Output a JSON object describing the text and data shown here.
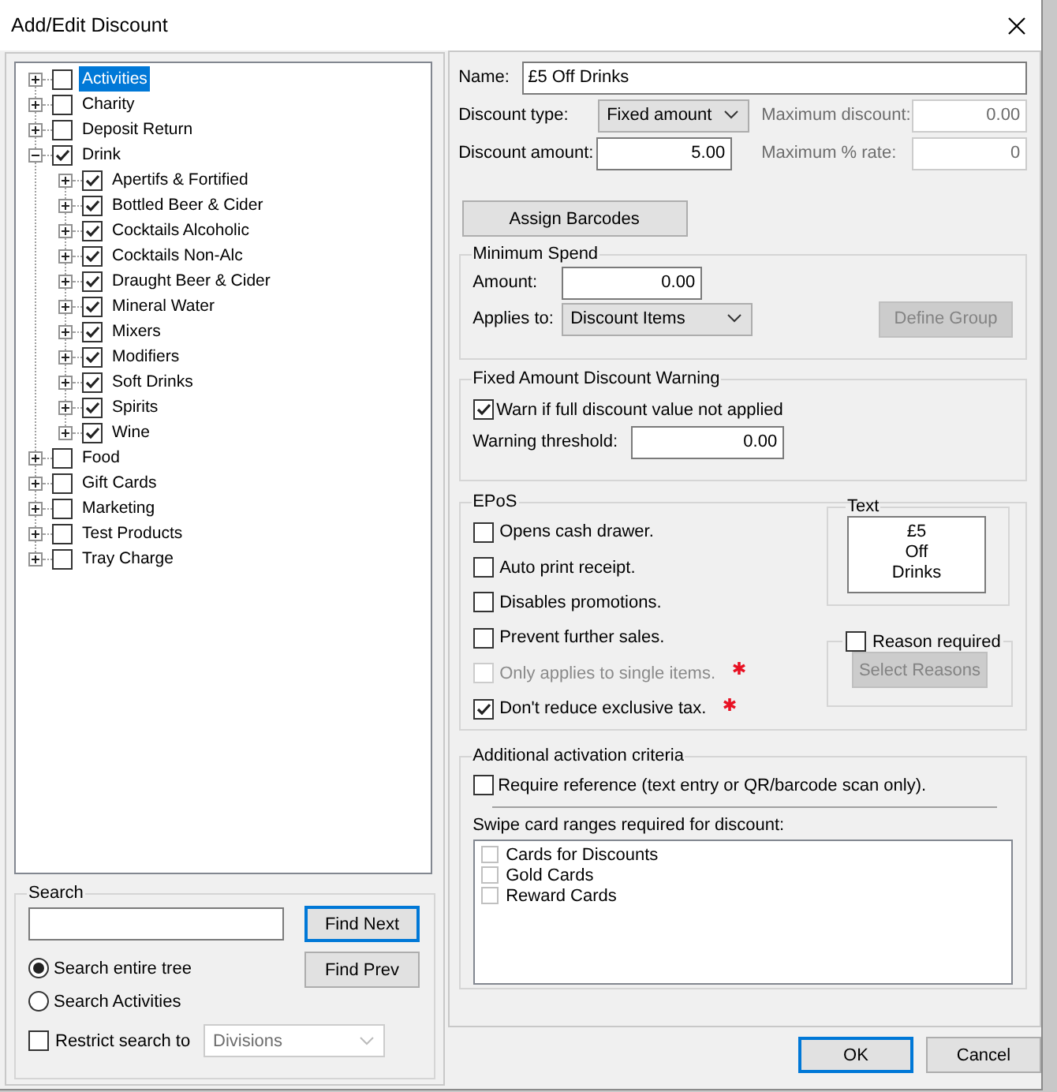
{
  "window": {
    "title": "Add/Edit Discount"
  },
  "tree": [
    {
      "label": "Activities",
      "checked": false,
      "expanded": false,
      "selected": true
    },
    {
      "label": "Charity",
      "checked": false,
      "expanded": false,
      "selected": false
    },
    {
      "label": "Deposit Return",
      "checked": false,
      "expanded": false,
      "selected": false
    },
    {
      "label": "Drink",
      "checked": true,
      "expanded": true,
      "selected": false,
      "children": [
        {
          "label": "Apertifs & Fortified",
          "checked": true,
          "expanded": false,
          "selected": false
        },
        {
          "label": "Bottled Beer & Cider",
          "checked": true,
          "expanded": false,
          "selected": false
        },
        {
          "label": "Cocktails Alcoholic",
          "checked": true,
          "expanded": false,
          "selected": false
        },
        {
          "label": "Cocktails Non-Alc",
          "checked": true,
          "expanded": false,
          "selected": false
        },
        {
          "label": "Draught Beer & Cider",
          "checked": true,
          "expanded": false,
          "selected": false
        },
        {
          "label": "Mineral Water",
          "checked": true,
          "expanded": false,
          "selected": false
        },
        {
          "label": "Mixers",
          "checked": true,
          "expanded": false,
          "selected": false
        },
        {
          "label": "Modifiers",
          "checked": true,
          "expanded": false,
          "selected": false
        },
        {
          "label": "Soft Drinks",
          "checked": true,
          "expanded": false,
          "selected": false
        },
        {
          "label": "Spirits",
          "checked": true,
          "expanded": false,
          "selected": false
        },
        {
          "label": "Wine",
          "checked": true,
          "expanded": false,
          "selected": false
        }
      ]
    },
    {
      "label": "Food",
      "checked": false,
      "expanded": false,
      "selected": false
    },
    {
      "label": "Gift Cards",
      "checked": false,
      "expanded": false,
      "selected": false
    },
    {
      "label": "Marketing",
      "checked": false,
      "expanded": false,
      "selected": false
    },
    {
      "label": "Test Products",
      "checked": false,
      "expanded": false,
      "selected": false
    },
    {
      "label": "Tray Charge",
      "checked": false,
      "expanded": false,
      "selected": false
    }
  ],
  "search": {
    "title": "Search",
    "find_next": "Find Next",
    "find_prev": "Find Prev",
    "scope": [
      {
        "label": "Search entire tree",
        "selected": true
      },
      {
        "label": "Search Activities",
        "selected": false
      }
    ],
    "restrict": {
      "label": "Restrict search to",
      "checked": false
    },
    "restrict_select": {
      "value": "Divisions",
      "disabled": true
    }
  },
  "form": {
    "name": {
      "label": "Name:",
      "value": "£5 Off Drinks"
    },
    "discount_type": {
      "label": "Discount type:",
      "value": "Fixed amount"
    },
    "max_discount": {
      "label": "Maximum discount:",
      "value": "0.00",
      "disabled": true
    },
    "discount_amount": {
      "label": "Discount amount:",
      "value": "5.00"
    },
    "max_rate": {
      "label": "Maximum % rate:",
      "value": "0",
      "disabled": true
    },
    "assign_barcodes": "Assign Barcodes"
  },
  "minimum_spend": {
    "title": "Minimum Spend",
    "amount_label": "Amount:",
    "amount": "0.00",
    "applies_label": "Applies to:",
    "applies_value": "Discount Items",
    "define_group": {
      "label": "Define Group",
      "disabled": true
    }
  },
  "warning": {
    "title": "Fixed Amount Discount Warning",
    "warn": {
      "label": "Warn if full discount value not applied",
      "checked": true
    },
    "threshold_label": "Warning threshold:",
    "threshold": "0.00"
  },
  "epos": {
    "title": "EPoS",
    "options": [
      {
        "label": "Opens cash drawer.",
        "checked": false,
        "disabled": false,
        "required": false
      },
      {
        "label": "Auto print receipt.",
        "checked": false,
        "disabled": false,
        "required": false
      },
      {
        "label": "Disables promotions.",
        "checked": false,
        "disabled": false,
        "required": false
      },
      {
        "label": "Prevent further sales.",
        "checked": false,
        "disabled": false,
        "required": false
      },
      {
        "label": "Only applies to single items.",
        "checked": false,
        "disabled": true,
        "required": true
      },
      {
        "label": "Don't reduce exclusive tax.",
        "checked": true,
        "disabled": false,
        "required": true
      }
    ],
    "text_title": "Text",
    "text_lines": [
      "£5",
      "Off",
      "Drinks"
    ],
    "reason": {
      "label": "Reason required",
      "checked": false
    },
    "select_reasons": {
      "label": "Select Reasons",
      "disabled": true
    }
  },
  "activation": {
    "title": "Additional activation criteria",
    "require": {
      "label": "Require reference (text entry or QR/barcode scan only).",
      "checked": false
    },
    "swipe_label": "Swipe card ranges required for discount:",
    "cards": [
      {
        "label": "Cards for Discounts",
        "checked": false
      },
      {
        "label": "Gold Cards",
        "checked": false
      },
      {
        "label": "Reward Cards",
        "checked": false
      }
    ]
  },
  "buttons": [
    {
      "label": "OK",
      "default": true
    },
    {
      "label": "Cancel",
      "default": false
    }
  ]
}
